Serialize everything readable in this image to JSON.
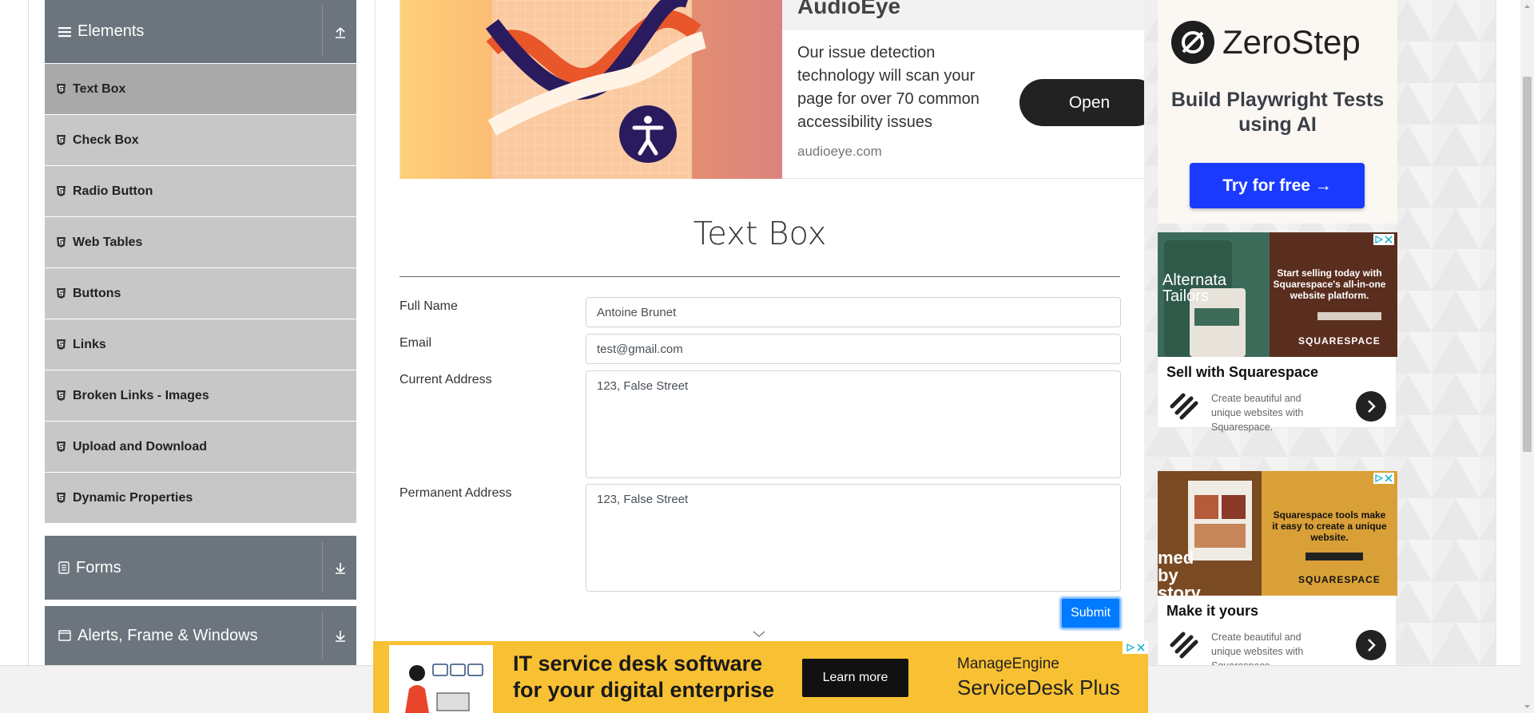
{
  "sidebar": {
    "elements_group": {
      "title": "Elements",
      "toggle_icon": "upload-arrow-icon"
    },
    "items": [
      {
        "label": "Text Box",
        "active": true
      },
      {
        "label": "Check Box"
      },
      {
        "label": "Radio Button"
      },
      {
        "label": "Web Tables"
      },
      {
        "label": "Buttons"
      },
      {
        "label": "Links"
      },
      {
        "label": "Broken Links - Images"
      },
      {
        "label": "Upload and Download"
      },
      {
        "label": "Dynamic Properties"
      }
    ],
    "forms_group": {
      "title": "Forms",
      "toggle_icon": "download-arrow-icon"
    },
    "alerts_group": {
      "title": "Alerts, Frame & Windows",
      "toggle_icon": "download-arrow-icon"
    }
  },
  "top_ad": {
    "brand": "AudioEye",
    "copy": "Our issue detection technology will scan your page for over 70 common accessibility issues",
    "domain": "audioeye.com",
    "button": "Open"
  },
  "form": {
    "heading": "Text Box",
    "full_name_label": "Full Name",
    "full_name_value": "Antoine Brunet",
    "email_label": "Email",
    "email_value": "test@gmail.com",
    "current_address_label": "Current Address",
    "current_address_value": "123, False Street",
    "permanent_address_label": "Permanent Address",
    "permanent_address_value": "123, False Street",
    "submit_label": "Submit"
  },
  "right_ads": {
    "zerostep": {
      "brand": "ZeroStep",
      "headline": "Build Playwright Tests using AI",
      "button": "Try for free →"
    },
    "squarespace_1": {
      "image_card_title": "Alternata Tailors",
      "image_tagline": "Start selling today with Squarespace's all-in-one website platform.",
      "image_footer": "SQUARESPACE",
      "headline": "Sell with Squarespace",
      "description": "Create beautiful and unique websites with Squarespace."
    },
    "squarespace_2": {
      "image_tagline": "Squarespace tools make it easy to create a unique website.",
      "image_side_text": "med by story",
      "image_footer": "SQUARESPACE",
      "headline": "Make it yours",
      "description": "Create beautiful and unique websites with Squarespace."
    }
  },
  "bottom_ad": {
    "headline_line1": "IT service desk software",
    "headline_line2": "for your digital enterprise",
    "button": "Learn more",
    "brand_line1": "ManageEngine",
    "brand_line2": "ServiceDesk Plus"
  },
  "colors": {
    "sidebar_header": "#6c757d",
    "sidebar_item": "#c7c7c7",
    "sidebar_item_active": "#a9a9a9",
    "submit": "#007bff",
    "zerostep_button": "#1a3bff",
    "bottom_ad_bg": "#f8c133"
  }
}
